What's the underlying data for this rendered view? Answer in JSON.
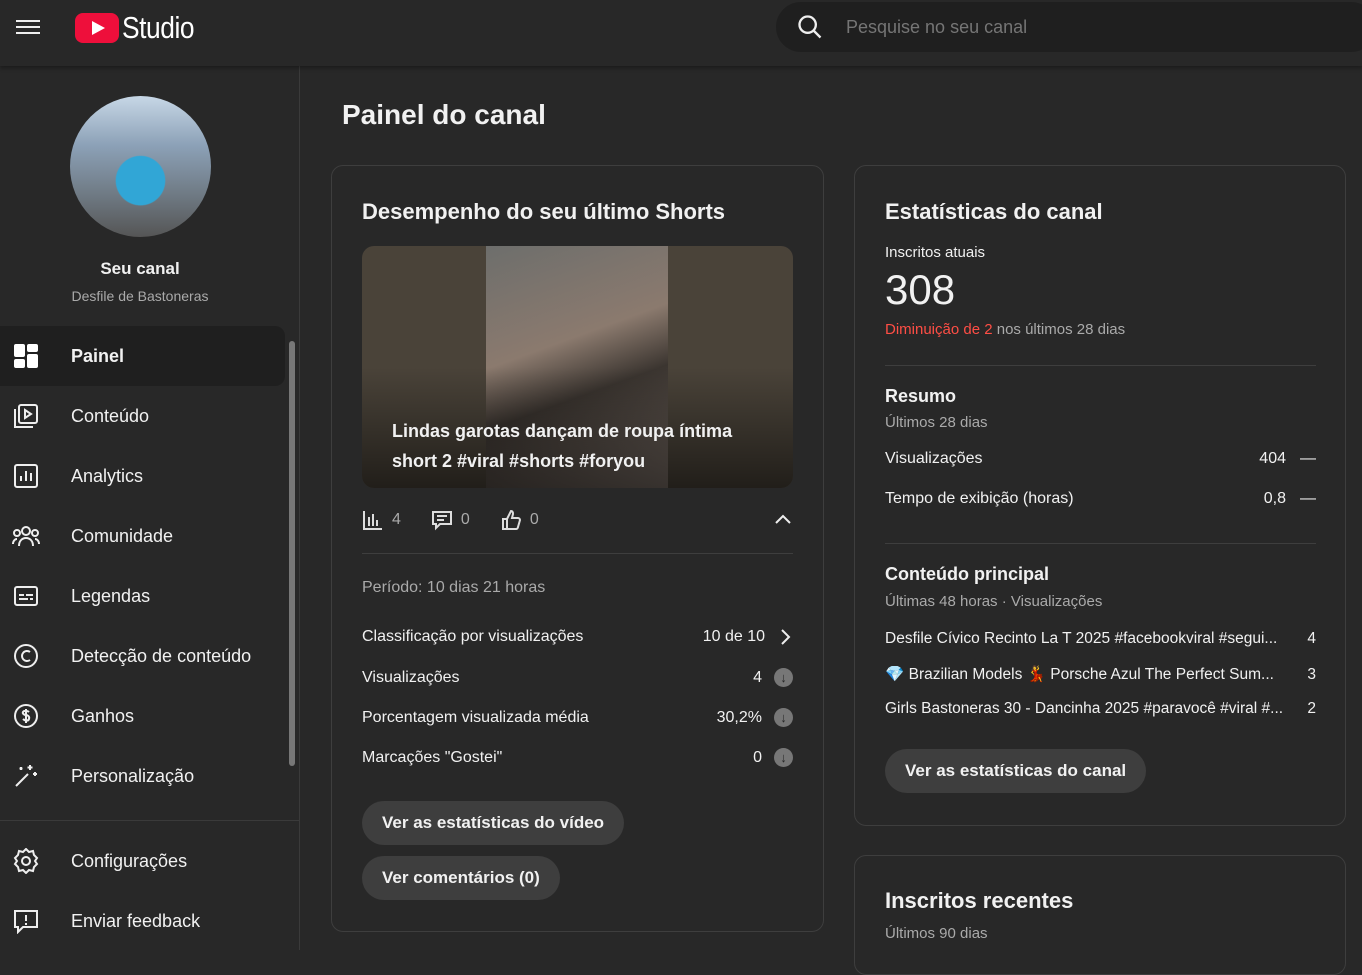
{
  "header": {
    "logo_text": "Studio",
    "search_placeholder": "Pesquise no seu canal"
  },
  "sidebar": {
    "channel_label": "Seu canal",
    "channel_name": "Desfile de Bastoneras",
    "items": [
      {
        "label": "Painel",
        "icon": "dashboard-icon"
      },
      {
        "label": "Conteúdo",
        "icon": "content-icon"
      },
      {
        "label": "Analytics",
        "icon": "analytics-icon"
      },
      {
        "label": "Comunidade",
        "icon": "community-icon"
      },
      {
        "label": "Legendas",
        "icon": "subtitles-icon"
      },
      {
        "label": "Detecção de conteúdo",
        "icon": "copyright-icon"
      },
      {
        "label": "Ganhos",
        "icon": "earn-icon"
      },
      {
        "label": "Personalização",
        "icon": "magic-wand-icon"
      }
    ],
    "bottom": [
      {
        "label": "Configurações",
        "icon": "gear-icon"
      },
      {
        "label": "Enviar feedback",
        "icon": "feedback-icon"
      }
    ]
  },
  "page": {
    "title": "Painel do canal"
  },
  "shorts": {
    "title": "Desempenho do seu último Shorts",
    "video_title": "Lindas garotas dançam de roupa íntima short 2 #viral #shorts #foryou",
    "views": "4",
    "comments": "0",
    "likes": "0",
    "period": "Período: 10 dias 21 horas",
    "stats": [
      {
        "label": "Classificação por visualizações",
        "value": "10 de 10"
      },
      {
        "label": "Visualizações",
        "value": "4"
      },
      {
        "label": "Porcentagem visualizada média",
        "value": "30,2%"
      },
      {
        "label": "Marcações \"Gostei\"",
        "value": "0"
      }
    ],
    "btn_stats": "Ver as estatísticas do vídeo",
    "btn_comments": "Ver comentários (0)"
  },
  "channel": {
    "title": "Estatísticas do canal",
    "subs_label": "Inscritos atuais",
    "subs": "308",
    "change_red": "Diminuição de 2",
    "change_rest": " nos últimos 28 dias",
    "summary_title": "Resumo",
    "summary_sub": "Últimos 28 dias",
    "summary": [
      {
        "label": "Visualizações",
        "value": "404",
        "trend": "—"
      },
      {
        "label": "Tempo de exibição (horas)",
        "value": "0,8",
        "trend": "—"
      }
    ],
    "top_title": "Conteúdo principal",
    "top_sub": "Últimas 48 horas · Visualizações",
    "top": [
      {
        "title": "Desfile Cívico Recinto La T 2025 #facebookviral #segui...",
        "views": "4"
      },
      {
        "title": "💎 Brazilian Models 💃 Porsche Azul The Perfect Sum...",
        "views": "3"
      },
      {
        "title": "Girls Bastoneras 30 - Dancinha 2025 #paravocê #viral #...",
        "views": "2"
      }
    ],
    "btn": "Ver as estatísticas do canal"
  },
  "recent": {
    "title": "Inscritos recentes",
    "sub": "Últimos 90 dias"
  },
  "colors": {
    "accent_red": "#ee0f3b",
    "decrease": "#ff4e45"
  }
}
